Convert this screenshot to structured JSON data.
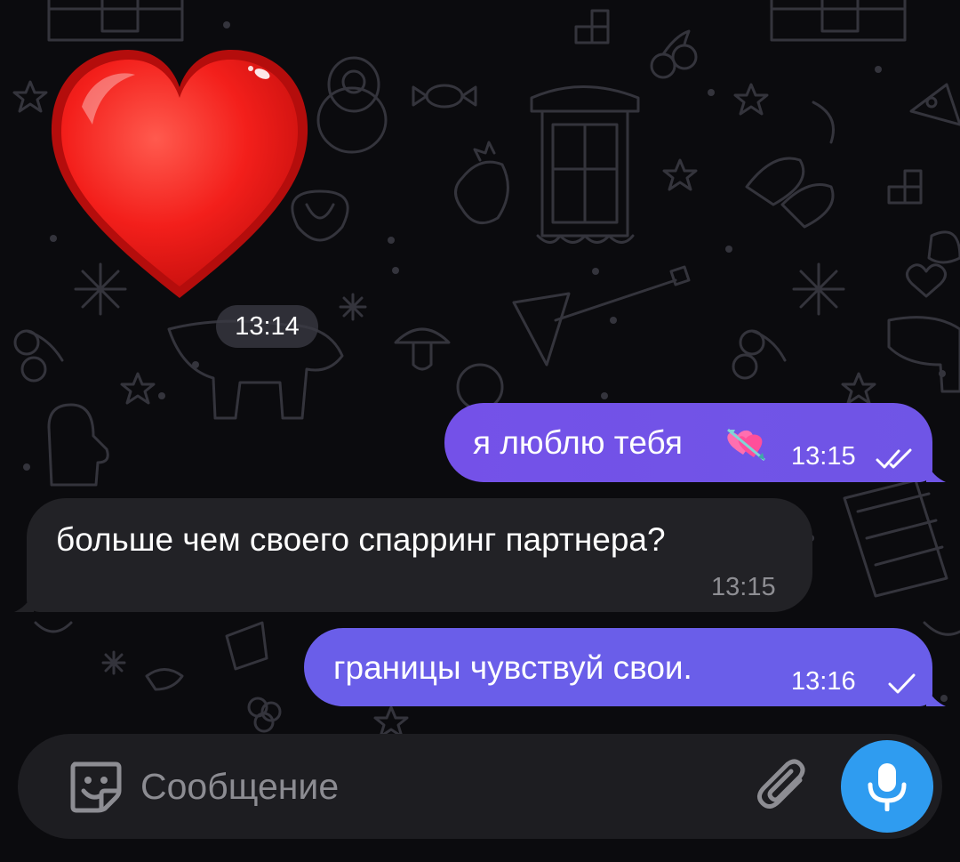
{
  "colors": {
    "outgoing_bubble": "#6f55e6",
    "incoming_bubble": "#222226",
    "mic_button": "#2f9cf0",
    "background": "#0b0b0e"
  },
  "messages": [
    {
      "type": "sticker",
      "sticker_icon": "red-heart-sticker",
      "time": "13:14",
      "direction": "incoming"
    },
    {
      "type": "text",
      "direction": "outgoing",
      "text": "я люблю тебя",
      "emoji_icon": "heart-with-arrow-emoji",
      "time": "13:15",
      "status": "read",
      "status_icon": "double-check-icon"
    },
    {
      "type": "text",
      "direction": "incoming",
      "text": "больше чем своего спарринг партнера?",
      "time": "13:15"
    },
    {
      "type": "text",
      "direction": "outgoing",
      "text": "границы чувствуй свои.",
      "time": "13:16",
      "status": "sent",
      "status_icon": "single-check-icon"
    }
  ],
  "composer": {
    "placeholder": "Сообщение",
    "value": "",
    "sticker_icon": "sticker-icon",
    "attach_icon": "paperclip-icon",
    "mic_icon": "microphone-icon"
  }
}
